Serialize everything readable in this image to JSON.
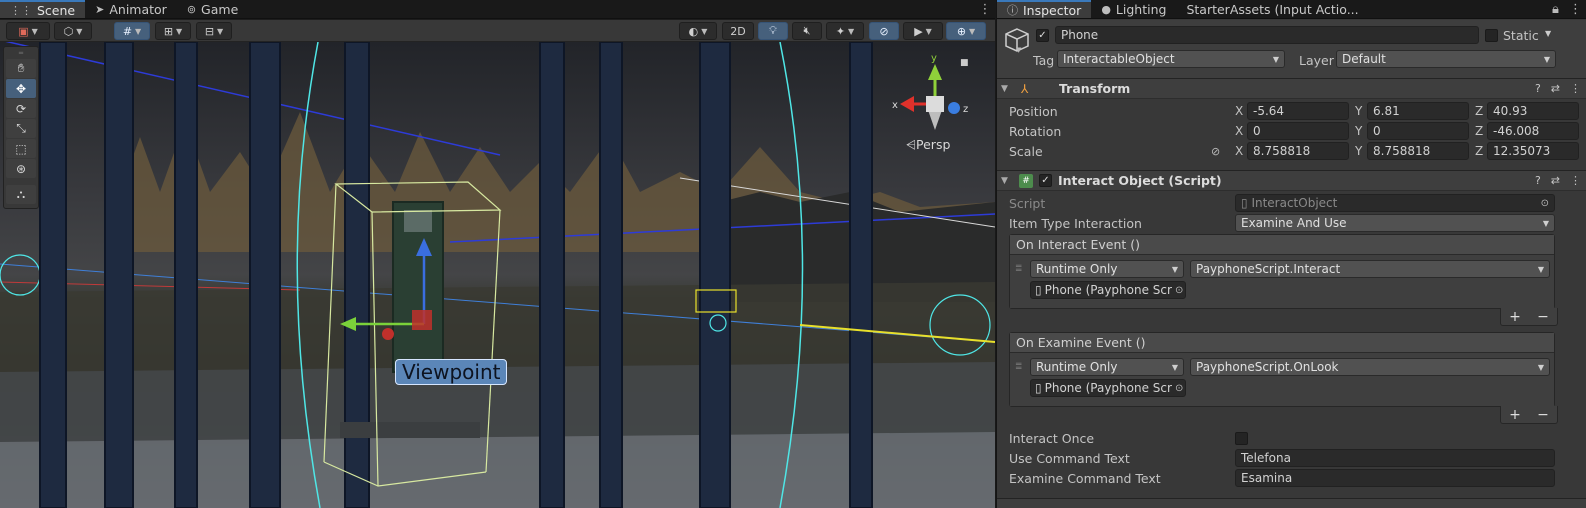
{
  "scene_tabs": [
    {
      "icon": "grid-icon",
      "label": "Scene",
      "active": true
    },
    {
      "icon": "animator-icon",
      "label": "Animator",
      "active": false
    },
    {
      "icon": "game-icon",
      "label": "Game",
      "active": false
    }
  ],
  "scene_toolbar": {
    "mode_2d_label": "2D"
  },
  "viewport": {
    "viewpoint_label": "Viewpoint",
    "persp_label": "Persp",
    "gizmo": {
      "x": "x",
      "y": "y",
      "z": "z"
    }
  },
  "inspector_tabs": [
    {
      "icon": "info-icon",
      "label": "Inspector",
      "active": true
    },
    {
      "icon": "bulb-icon",
      "label": "Lighting",
      "active": false
    },
    {
      "icon": "",
      "label": "StarterAssets (Input Actio...",
      "active": false
    }
  ],
  "gameobject": {
    "name": "Phone",
    "active": true,
    "static_label": "Static",
    "tag_label": "Tag",
    "tag_value": "InteractableObject",
    "layer_label": "Layer",
    "layer_value": "Default"
  },
  "transform": {
    "title": "Transform",
    "position_label": "Position",
    "rotation_label": "Rotation",
    "scale_label": "Scale",
    "position": {
      "x": "-5.64",
      "y": "6.81",
      "z": "40.93"
    },
    "rotation": {
      "x": "0",
      "y": "0",
      "z": "-46.008"
    },
    "scale": {
      "x": "8.758818",
      "y": "8.758818",
      "z": "12.35073"
    }
  },
  "interact_script": {
    "title": "Interact Object (Script)",
    "enabled": true,
    "script_label": "Script",
    "script_value": "InteractObject",
    "item_type_label": "Item Type Interaction",
    "item_type_value": "Examine And Use",
    "on_interact": {
      "title": "On Interact Event ()",
      "mode": "Runtime Only",
      "function": "PayphoneScript.Interact",
      "target": "Phone (Payphone Scr"
    },
    "on_examine": {
      "title": "On Examine Event ()",
      "mode": "Runtime Only",
      "function": "PayphoneScript.OnLook",
      "target": "Phone (Payphone Scr"
    },
    "interact_once_label": "Interact Once",
    "interact_once": false,
    "use_command_label": "Use Command Text",
    "use_command_value": "Telefona",
    "examine_command_label": "Examine Command Text",
    "examine_command_value": "Esamina"
  },
  "colors": {
    "accent_blue": "#3a79bb",
    "selection_outline": "#4fe6e6",
    "gizmo_x": "#e0312b",
    "gizmo_y": "#8fd13a",
    "gizmo_z": "#3a7de0"
  }
}
